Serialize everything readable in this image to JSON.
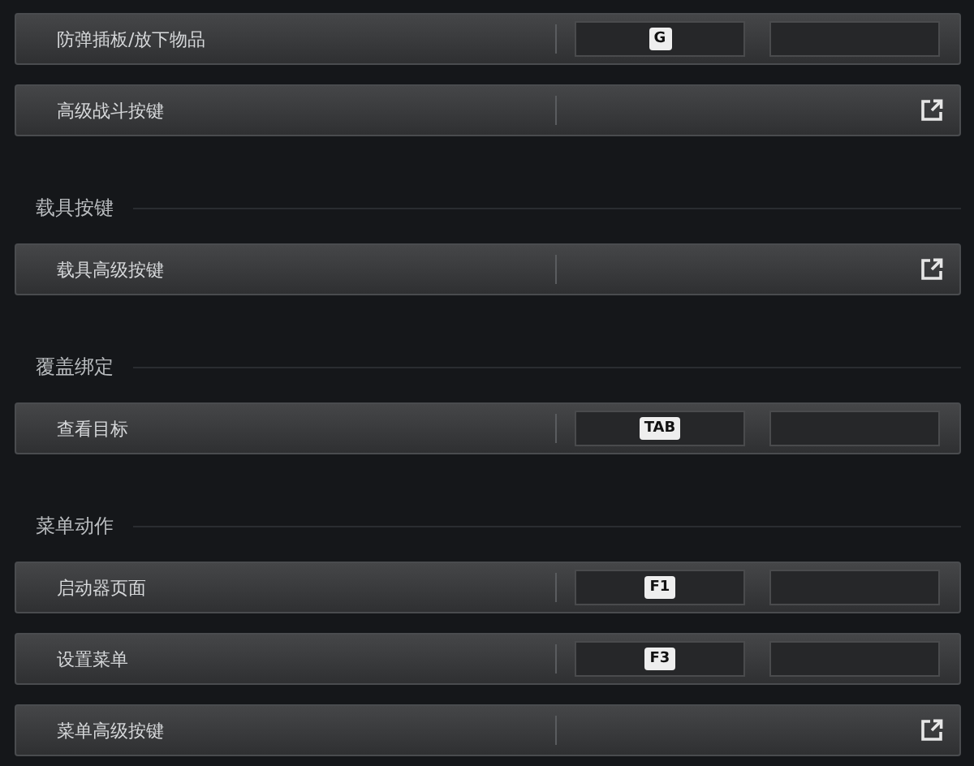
{
  "sections": [
    {
      "rows": [
        {
          "kind": "binding",
          "label": "防弹插板/放下物品",
          "keys": [
            "G"
          ]
        },
        {
          "kind": "link",
          "label": "高级战斗按键"
        }
      ]
    },
    {
      "title": "载具按键",
      "rows": [
        {
          "kind": "link",
          "label": "载具高级按键"
        }
      ]
    },
    {
      "title": "覆盖绑定",
      "rows": [
        {
          "kind": "binding",
          "label": "查看目标",
          "keys": [
            "TAB"
          ]
        }
      ]
    },
    {
      "title": "菜单动作",
      "rows": [
        {
          "kind": "binding",
          "label": "启动器页面",
          "keys": [
            "F1"
          ]
        },
        {
          "kind": "binding",
          "label": "设置菜单",
          "keys": [
            "F3"
          ]
        },
        {
          "kind": "link",
          "label": "菜单高级按键"
        }
      ]
    }
  ]
}
